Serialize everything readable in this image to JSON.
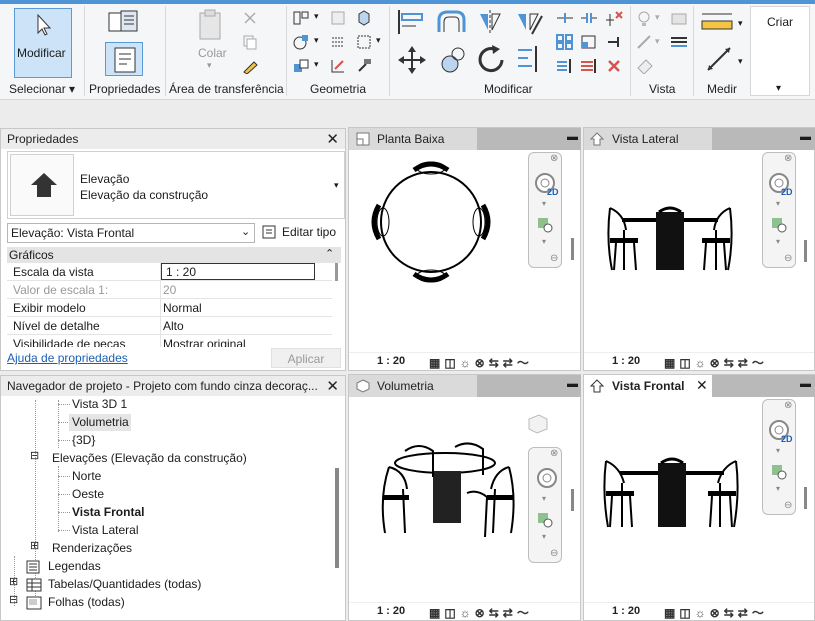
{
  "ribbon": {
    "groups": {
      "selecionar": "Selecionar",
      "propriedades": "Propriedades",
      "transferencia": "Área de transferência",
      "geometria": "Geometria",
      "modificar": "Modificar",
      "vista": "Vista",
      "medir": "Medir",
      "criar": "Criar"
    },
    "modificar_button": "Modificar",
    "colar": "Colar"
  },
  "properties": {
    "title": "Propriedades",
    "type_name": "Elevação",
    "type_sub": "Elevação da construção",
    "selector": "Elevação: Vista Frontal",
    "edit_type": "Editar tipo",
    "section": "Gráficos",
    "rows": [
      {
        "key": "Escala da vista",
        "value": "1 : 20"
      },
      {
        "key": "Valor de escala    1:",
        "value": "20"
      },
      {
        "key": "Exibir modelo",
        "value": "Normal"
      },
      {
        "key": "Nível de detalhe",
        "value": "Alto"
      },
      {
        "key": "Visibilidade de peças",
        "value": "Mostrar original"
      }
    ],
    "help_link": "Ajuda de propriedades",
    "apply": "Aplicar"
  },
  "navigator": {
    "title": "Navegador de projeto - Projeto com fundo cinza decoraç...",
    "items": [
      "Vista 3D 1",
      "Volumetria",
      "{3D}",
      "Elevações (Elevação da construção)",
      "Norte",
      "Oeste",
      "Vista Frontal",
      "Vista Lateral",
      "Renderizações",
      "Legendas",
      "Tabelas/Quantidades (todas)",
      "Folhas (todas)"
    ]
  },
  "views": {
    "planta": {
      "tab": "Planta Baixa",
      "scale": "1 : 20"
    },
    "lateral": {
      "tab": "Vista Lateral",
      "scale": "1 : 20"
    },
    "volumetria": {
      "tab": "Volumetria",
      "scale": "1 : 20"
    },
    "frontal": {
      "tab": "Vista Frontal",
      "scale": "1 : 20"
    }
  },
  "navwheel_2d": "2D"
}
